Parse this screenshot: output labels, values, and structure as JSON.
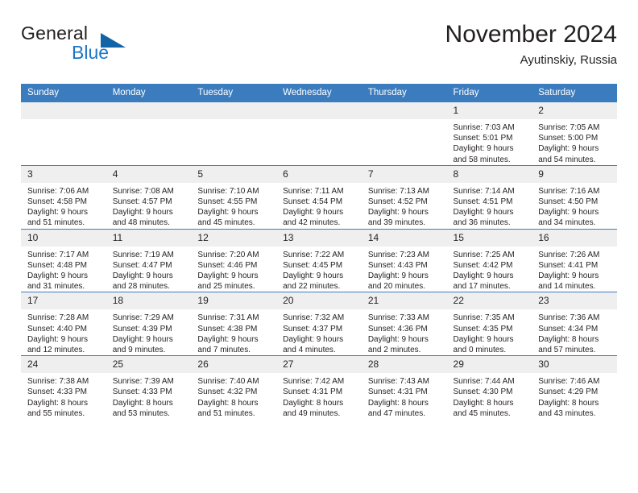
{
  "brand": {
    "name_part1": "General",
    "name_part2": "Blue",
    "triangle_icon": "brand-triangle-icon",
    "accent_color": "#1b76c7",
    "triangle_color": "#1063a6"
  },
  "header": {
    "title": "November 2024",
    "subtitle": "Ayutinskiy, Russia"
  },
  "calendar": {
    "header_bg_color": "#3b7cbf",
    "daynum_bg_color": "#efefef",
    "weekday_headers": [
      "Sunday",
      "Monday",
      "Tuesday",
      "Wednesday",
      "Thursday",
      "Friday",
      "Saturday"
    ],
    "weeks": [
      [
        {
          "day": "",
          "sunrise": "",
          "sunset": "",
          "daylight_line1": "",
          "daylight_line2": ""
        },
        {
          "day": "",
          "sunrise": "",
          "sunset": "",
          "daylight_line1": "",
          "daylight_line2": ""
        },
        {
          "day": "",
          "sunrise": "",
          "sunset": "",
          "daylight_line1": "",
          "daylight_line2": ""
        },
        {
          "day": "",
          "sunrise": "",
          "sunset": "",
          "daylight_line1": "",
          "daylight_line2": ""
        },
        {
          "day": "",
          "sunrise": "",
          "sunset": "",
          "daylight_line1": "",
          "daylight_line2": ""
        },
        {
          "day": "1",
          "sunrise": "Sunrise: 7:03 AM",
          "sunset": "Sunset: 5:01 PM",
          "daylight_line1": "Daylight: 9 hours",
          "daylight_line2": "and 58 minutes."
        },
        {
          "day": "2",
          "sunrise": "Sunrise: 7:05 AM",
          "sunset": "Sunset: 5:00 PM",
          "daylight_line1": "Daylight: 9 hours",
          "daylight_line2": "and 54 minutes."
        }
      ],
      [
        {
          "day": "3",
          "sunrise": "Sunrise: 7:06 AM",
          "sunset": "Sunset: 4:58 PM",
          "daylight_line1": "Daylight: 9 hours",
          "daylight_line2": "and 51 minutes."
        },
        {
          "day": "4",
          "sunrise": "Sunrise: 7:08 AM",
          "sunset": "Sunset: 4:57 PM",
          "daylight_line1": "Daylight: 9 hours",
          "daylight_line2": "and 48 minutes."
        },
        {
          "day": "5",
          "sunrise": "Sunrise: 7:10 AM",
          "sunset": "Sunset: 4:55 PM",
          "daylight_line1": "Daylight: 9 hours",
          "daylight_line2": "and 45 minutes."
        },
        {
          "day": "6",
          "sunrise": "Sunrise: 7:11 AM",
          "sunset": "Sunset: 4:54 PM",
          "daylight_line1": "Daylight: 9 hours",
          "daylight_line2": "and 42 minutes."
        },
        {
          "day": "7",
          "sunrise": "Sunrise: 7:13 AM",
          "sunset": "Sunset: 4:52 PM",
          "daylight_line1": "Daylight: 9 hours",
          "daylight_line2": "and 39 minutes."
        },
        {
          "day": "8",
          "sunrise": "Sunrise: 7:14 AM",
          "sunset": "Sunset: 4:51 PM",
          "daylight_line1": "Daylight: 9 hours",
          "daylight_line2": "and 36 minutes."
        },
        {
          "day": "9",
          "sunrise": "Sunrise: 7:16 AM",
          "sunset": "Sunset: 4:50 PM",
          "daylight_line1": "Daylight: 9 hours",
          "daylight_line2": "and 34 minutes."
        }
      ],
      [
        {
          "day": "10",
          "sunrise": "Sunrise: 7:17 AM",
          "sunset": "Sunset: 4:48 PM",
          "daylight_line1": "Daylight: 9 hours",
          "daylight_line2": "and 31 minutes."
        },
        {
          "day": "11",
          "sunrise": "Sunrise: 7:19 AM",
          "sunset": "Sunset: 4:47 PM",
          "daylight_line1": "Daylight: 9 hours",
          "daylight_line2": "and 28 minutes."
        },
        {
          "day": "12",
          "sunrise": "Sunrise: 7:20 AM",
          "sunset": "Sunset: 4:46 PM",
          "daylight_line1": "Daylight: 9 hours",
          "daylight_line2": "and 25 minutes."
        },
        {
          "day": "13",
          "sunrise": "Sunrise: 7:22 AM",
          "sunset": "Sunset: 4:45 PM",
          "daylight_line1": "Daylight: 9 hours",
          "daylight_line2": "and 22 minutes."
        },
        {
          "day": "14",
          "sunrise": "Sunrise: 7:23 AM",
          "sunset": "Sunset: 4:43 PM",
          "daylight_line1": "Daylight: 9 hours",
          "daylight_line2": "and 20 minutes."
        },
        {
          "day": "15",
          "sunrise": "Sunrise: 7:25 AM",
          "sunset": "Sunset: 4:42 PM",
          "daylight_line1": "Daylight: 9 hours",
          "daylight_line2": "and 17 minutes."
        },
        {
          "day": "16",
          "sunrise": "Sunrise: 7:26 AM",
          "sunset": "Sunset: 4:41 PM",
          "daylight_line1": "Daylight: 9 hours",
          "daylight_line2": "and 14 minutes."
        }
      ],
      [
        {
          "day": "17",
          "sunrise": "Sunrise: 7:28 AM",
          "sunset": "Sunset: 4:40 PM",
          "daylight_line1": "Daylight: 9 hours",
          "daylight_line2": "and 12 minutes."
        },
        {
          "day": "18",
          "sunrise": "Sunrise: 7:29 AM",
          "sunset": "Sunset: 4:39 PM",
          "daylight_line1": "Daylight: 9 hours",
          "daylight_line2": "and 9 minutes."
        },
        {
          "day": "19",
          "sunrise": "Sunrise: 7:31 AM",
          "sunset": "Sunset: 4:38 PM",
          "daylight_line1": "Daylight: 9 hours",
          "daylight_line2": "and 7 minutes."
        },
        {
          "day": "20",
          "sunrise": "Sunrise: 7:32 AM",
          "sunset": "Sunset: 4:37 PM",
          "daylight_line1": "Daylight: 9 hours",
          "daylight_line2": "and 4 minutes."
        },
        {
          "day": "21",
          "sunrise": "Sunrise: 7:33 AM",
          "sunset": "Sunset: 4:36 PM",
          "daylight_line1": "Daylight: 9 hours",
          "daylight_line2": "and 2 minutes."
        },
        {
          "day": "22",
          "sunrise": "Sunrise: 7:35 AM",
          "sunset": "Sunset: 4:35 PM",
          "daylight_line1": "Daylight: 9 hours",
          "daylight_line2": "and 0 minutes."
        },
        {
          "day": "23",
          "sunrise": "Sunrise: 7:36 AM",
          "sunset": "Sunset: 4:34 PM",
          "daylight_line1": "Daylight: 8 hours",
          "daylight_line2": "and 57 minutes."
        }
      ],
      [
        {
          "day": "24",
          "sunrise": "Sunrise: 7:38 AM",
          "sunset": "Sunset: 4:33 PM",
          "daylight_line1": "Daylight: 8 hours",
          "daylight_line2": "and 55 minutes."
        },
        {
          "day": "25",
          "sunrise": "Sunrise: 7:39 AM",
          "sunset": "Sunset: 4:33 PM",
          "daylight_line1": "Daylight: 8 hours",
          "daylight_line2": "and 53 minutes."
        },
        {
          "day": "26",
          "sunrise": "Sunrise: 7:40 AM",
          "sunset": "Sunset: 4:32 PM",
          "daylight_line1": "Daylight: 8 hours",
          "daylight_line2": "and 51 minutes."
        },
        {
          "day": "27",
          "sunrise": "Sunrise: 7:42 AM",
          "sunset": "Sunset: 4:31 PM",
          "daylight_line1": "Daylight: 8 hours",
          "daylight_line2": "and 49 minutes."
        },
        {
          "day": "28",
          "sunrise": "Sunrise: 7:43 AM",
          "sunset": "Sunset: 4:31 PM",
          "daylight_line1": "Daylight: 8 hours",
          "daylight_line2": "and 47 minutes."
        },
        {
          "day": "29",
          "sunrise": "Sunrise: 7:44 AM",
          "sunset": "Sunset: 4:30 PM",
          "daylight_line1": "Daylight: 8 hours",
          "daylight_line2": "and 45 minutes."
        },
        {
          "day": "30",
          "sunrise": "Sunrise: 7:46 AM",
          "sunset": "Sunset: 4:29 PM",
          "daylight_line1": "Daylight: 8 hours",
          "daylight_line2": "and 43 minutes."
        }
      ]
    ]
  }
}
